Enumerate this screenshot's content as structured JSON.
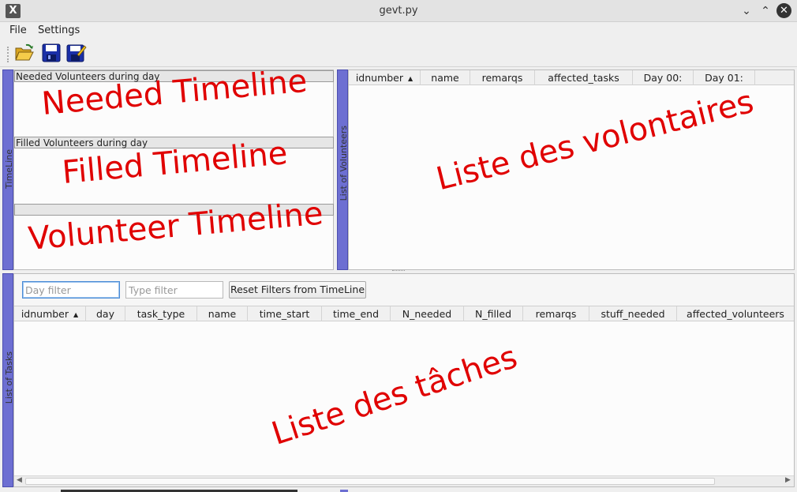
{
  "window": {
    "title": "gevt.py"
  },
  "menubar": {
    "items": [
      "File",
      "Settings"
    ]
  },
  "toolbar": {
    "icons": [
      "open-folder-icon",
      "save-icon",
      "save-as-icon"
    ]
  },
  "timeline": {
    "tab_label": "TimeLine",
    "needed_header": "Needed Volunteers during day",
    "needed_overlay": "Needed Timeline",
    "filled_header": "Filled Volunteers during day",
    "filled_overlay": "Filled Timeline",
    "volunteer_header": "",
    "volunteer_overlay": "Volunteer Timeline"
  },
  "volunteers": {
    "tab_label": "List of Volunteers",
    "columns": [
      "idnumber",
      "name",
      "remarqs",
      "affected_tasks",
      "Day 00:",
      "Day 01:"
    ],
    "sorted_column": "idnumber",
    "overlay": "Liste des volontaires"
  },
  "tasks": {
    "tab_label": "List of Tasks",
    "day_filter_placeholder": "Day filter",
    "type_filter_placeholder": "Type filter",
    "reset_button": "Reset Filters from TimeLine",
    "columns": [
      "idnumber",
      "day",
      "task_type",
      "name",
      "time_start",
      "time_end",
      "N_needed",
      "N_filled",
      "remarqs",
      "stuff_needed",
      "affected_volunteers"
    ],
    "sorted_column": "idnumber",
    "overlay": "Liste des tâches"
  },
  "colors": {
    "side_tab": "#6d6fd2",
    "annotation": "#e00000",
    "focus": "#4a8bd6"
  }
}
